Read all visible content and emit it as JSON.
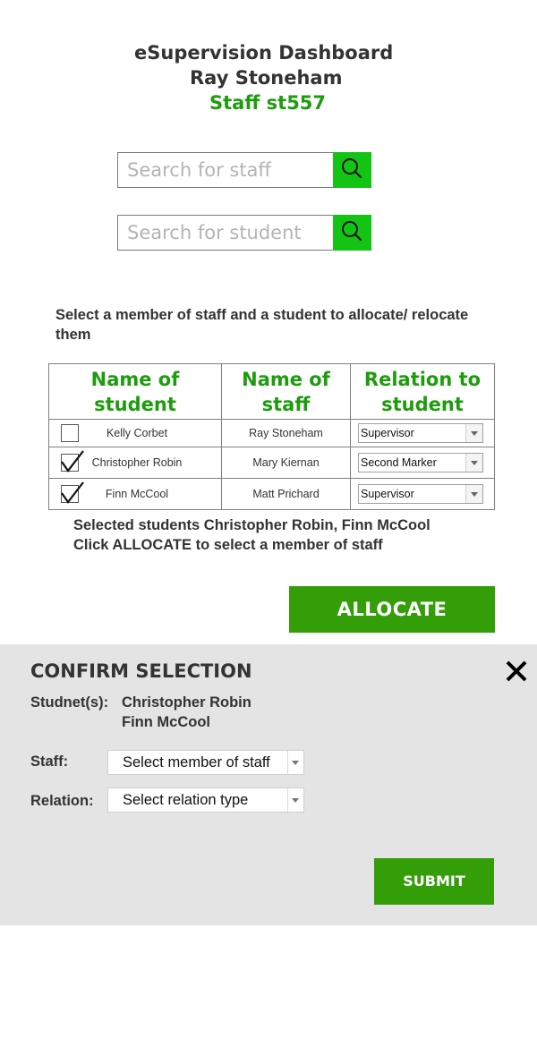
{
  "header": {
    "title": "eSupervision Dashboard",
    "user_name": "Ray Stoneham",
    "staff_id": "Staff st557"
  },
  "search": {
    "staff_placeholder": "Search for staff",
    "student_placeholder": "Search for student",
    "icon": "search-icon"
  },
  "instructions": "Select a member of staff  and a student to allocate/ relocate them",
  "table": {
    "headers": [
      "Name of student",
      "Name of staff",
      "Relation to student"
    ],
    "rows": [
      {
        "student": "Kelly Corbet",
        "staff": "Ray Stoneham",
        "relation": "Supervisor",
        "checked": false
      },
      {
        "student": "Christopher Robin",
        "staff": "Mary Kiernan",
        "relation": "Second Marker",
        "checked": true
      },
      {
        "student": "Finn McCool",
        "staff": "Matt Prichard",
        "relation": "Supervisor",
        "checked": true
      }
    ]
  },
  "selection": {
    "selected_text": "Selected students Christopher Robin, Finn McCool",
    "click_text": "Click ALLOCATE to select a member of staff"
  },
  "allocate_label": "ALLOCATE",
  "confirm": {
    "title": "CONFIRM SELECTION",
    "students_label": "Studnet(s):",
    "students": [
      "Christopher Robin",
      "Finn McCool"
    ],
    "staff_label": "Staff:",
    "staff_value": "Select member of staff",
    "relation_label": "Relation:",
    "relation_value": "Select relation type",
    "submit_label": "SUBMIT"
  },
  "colors": {
    "accent_green": "#1e9c0e",
    "button_green": "#349e08",
    "search_button": "#14c414",
    "panel_bg": "#e4e4e4"
  }
}
